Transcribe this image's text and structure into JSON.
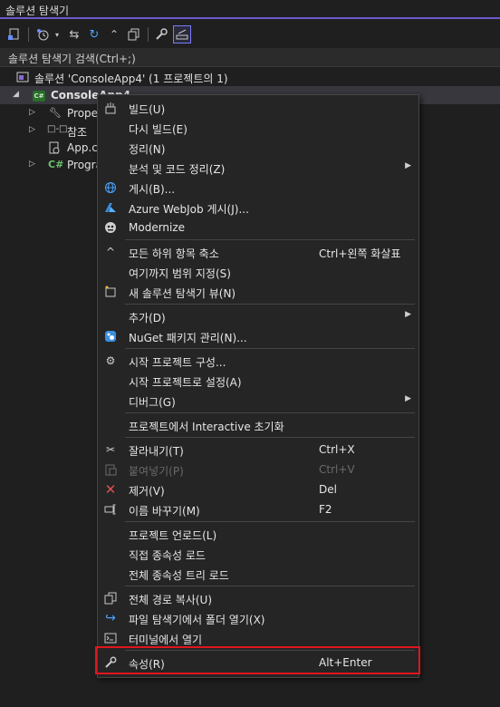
{
  "panel": {
    "title": "솔루션 탐색기"
  },
  "search": {
    "placeholder": "솔루션 탐색기 검색(Ctrl+;)"
  },
  "toolbar": {
    "items": [
      "switch-views-icon",
      "history-icon",
      "dropdown-arrow-icon",
      "sync-icon",
      "refresh-icon",
      "collapse-icon",
      "copy-icon",
      "wrench-icon",
      "preview-icon"
    ]
  },
  "tree": {
    "solution": "솔루션 'ConsoleApp4' (1 프로젝트의 1)",
    "project": "ConsoleApp4",
    "items": [
      {
        "label": "Proper",
        "icon": "wrench-icon"
      },
      {
        "label": "참조",
        "icon": "references-icon"
      },
      {
        "label": "App.co",
        "icon": "config-icon"
      },
      {
        "label": "Progra",
        "icon": "csharp-icon"
      }
    ]
  },
  "menu": {
    "items": [
      {
        "label": "빌드(U)",
        "icon": "build-icon",
        "shortcut": ""
      },
      {
        "label": "다시 빌드(E)",
        "icon": "",
        "shortcut": ""
      },
      {
        "label": "정리(N)",
        "icon": "",
        "shortcut": ""
      },
      {
        "label": "분석 및 코드 정리(Z)",
        "icon": "",
        "shortcut": "",
        "submenu": true
      },
      {
        "label": "게시(B)...",
        "icon": "globe-icon",
        "shortcut": ""
      },
      {
        "label": "Azure WebJob 게시(J)...",
        "icon": "azure-icon",
        "shortcut": ""
      },
      {
        "label": "Modernize",
        "icon": "modernize-icon",
        "shortcut": ""
      },
      {
        "label": "모든 하위 항목 축소",
        "icon": "collapse-icon",
        "shortcut": "Ctrl+왼쪽 화살표"
      },
      {
        "label": "여기까지 범위 지정(S)",
        "icon": "",
        "shortcut": ""
      },
      {
        "label": "새 솔루션 탐색기 뷰(N)",
        "icon": "new-view-icon",
        "shortcut": ""
      },
      {
        "label": "추가(D)",
        "icon": "",
        "shortcut": "",
        "submenu": true
      },
      {
        "label": "NuGet 패키지 관리(N)...",
        "icon": "nuget-icon",
        "shortcut": ""
      },
      {
        "label": "시작 프로젝트 구성...",
        "icon": "gear-icon",
        "shortcut": ""
      },
      {
        "label": "시작 프로젝트로 설정(A)",
        "icon": "",
        "shortcut": ""
      },
      {
        "label": "디버그(G)",
        "icon": "",
        "shortcut": "",
        "submenu": true
      },
      {
        "label": "프로젝트에서 Interactive 초기화",
        "icon": "",
        "shortcut": ""
      },
      {
        "label": "잘라내기(T)",
        "icon": "scissors-icon",
        "shortcut": "Ctrl+X"
      },
      {
        "label": "붙여넣기(P)",
        "icon": "paste-icon",
        "shortcut": "Ctrl+V",
        "disabled": true
      },
      {
        "label": "제거(V)",
        "icon": "delete-icon",
        "shortcut": "Del"
      },
      {
        "label": "이름 바꾸기(M)",
        "icon": "rename-icon",
        "shortcut": "F2"
      },
      {
        "label": "프로젝트 언로드(L)",
        "icon": "",
        "shortcut": ""
      },
      {
        "label": "직접 종속성 로드",
        "icon": "",
        "shortcut": ""
      },
      {
        "label": "전체 종속성 트리 로드",
        "icon": "",
        "shortcut": ""
      },
      {
        "label": "전체 경로 복사(U)",
        "icon": "copy-icon",
        "shortcut": ""
      },
      {
        "label": "파일 탐색기에서 폴더 열기(X)",
        "icon": "open-folder-icon",
        "shortcut": ""
      },
      {
        "label": "터미널에서 열기",
        "icon": "terminal-icon",
        "shortcut": ""
      },
      {
        "label": "속성(R)",
        "icon": "wrench-icon",
        "shortcut": "Alt+Enter"
      }
    ]
  },
  "colors": {
    "accent": "#6a5acd",
    "highlight_border": "#e0151e",
    "menu_bg": "#252526"
  }
}
